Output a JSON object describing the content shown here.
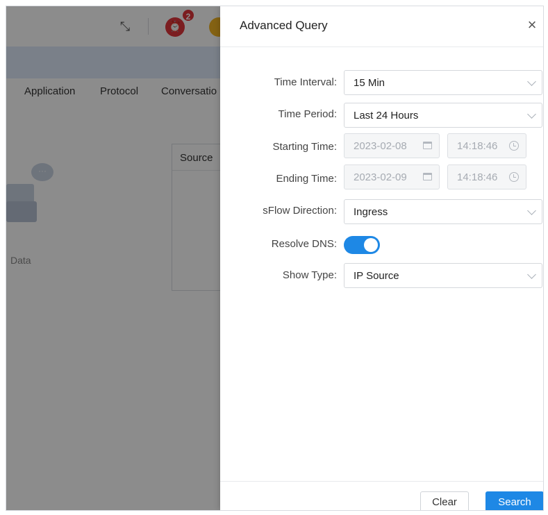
{
  "background": {
    "alarm_badge": "2",
    "tabs": [
      "Application",
      "Protocol",
      "Conversatio"
    ],
    "table_header": "Source",
    "empty_text": "Data"
  },
  "drawer": {
    "title": "Advanced Query",
    "fields": {
      "time_interval": {
        "label": "Time Interval:",
        "value": "15 Min"
      },
      "time_period": {
        "label": "Time Period:",
        "value": "Last 24 Hours"
      },
      "starting_time": {
        "label": "Starting Time:",
        "date": "2023-02-08",
        "time": "14:18:46"
      },
      "ending_time": {
        "label": "Ending Time:",
        "date": "2023-02-09",
        "time": "14:18:46"
      },
      "sflow_direction": {
        "label": "sFlow Direction:",
        "value": "Ingress"
      },
      "resolve_dns": {
        "label": "Resolve DNS:",
        "enabled": true
      },
      "show_type": {
        "label": "Show Type:",
        "value": "IP Source"
      }
    },
    "buttons": {
      "clear": "Clear",
      "search": "Search"
    }
  },
  "colors": {
    "accent": "#1e88e5",
    "alarm": "#e0353b",
    "user": "#f0b323"
  },
  "icons": [
    "fullscreen-icon",
    "alarm-icon",
    "user-avatar-icon",
    "close-icon",
    "chevron-down-icon",
    "calendar-icon",
    "clock-icon"
  ]
}
